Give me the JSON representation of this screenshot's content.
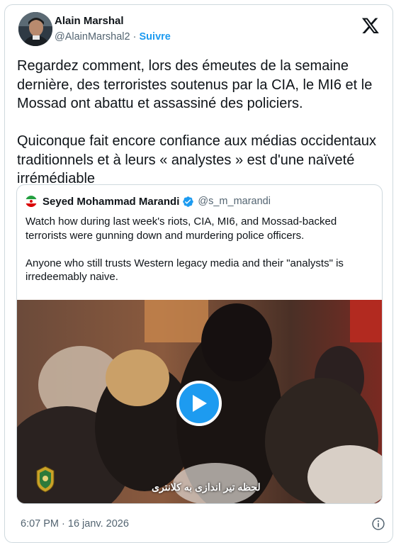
{
  "author": {
    "name": "Alain Marshal",
    "handle": "@AlainMarshal2",
    "separator": "·",
    "follow_label": "Suivre"
  },
  "tweet_text": "Regardez comment, lors des émeutes de la semaine dernière, des terroristes soutenus par la CIA, le MI6 et le Mossad ont abattu et assassiné des policiers.\n\nQuiconque fait encore confiance aux médias occidentaux traditionnels et à leurs « analystes » est d'une naïveté irrémédiable",
  "quoted": {
    "name": "Seyed Mohammad Marandi",
    "handle": "@s_m_marandi",
    "text": "Watch how during last week's riots, CIA, MI6, and Mossad-backed terrorists were gunning down and murdering police officers.\n\nAnyone who still trusts Western legacy media and their \"analysts\" is irredeemably naive.",
    "video_caption": "لحظه تیر اندازی به کلانتری"
  },
  "timestamp": "6:07 PM · 16 janv. 2026",
  "icons": {
    "brand": "x-logo-icon",
    "verified": "verified-badge-icon",
    "play": "play-icon",
    "info": "info-icon"
  },
  "colors": {
    "accent": "#1d9bf0",
    "text": "#0f1419",
    "secondary": "#536471",
    "border": "#cfd9de"
  }
}
